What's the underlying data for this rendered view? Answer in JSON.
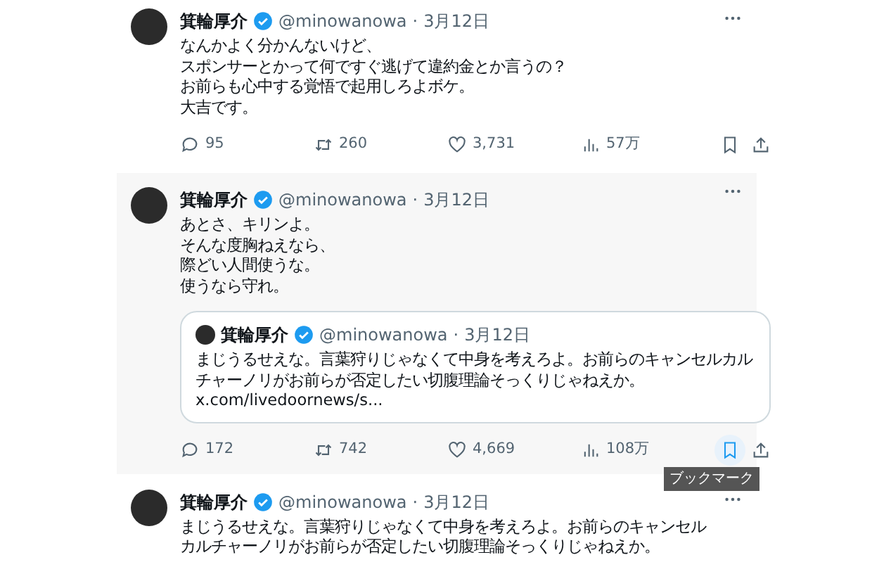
{
  "posts": [
    {
      "author": "箕輪厚介",
      "handle": "@minowanowa",
      "separator": "·",
      "date": "3月12日",
      "highlighted": false,
      "lines": [
        "なんかよく分かんないけど、",
        "スポンサーとかって何ですぐ逃げて違約金とか言うの？",
        "お前らも心中する覚悟で起用しろよボケ。",
        "大吉です。"
      ],
      "stats": {
        "replies": "95",
        "reposts": "260",
        "likes": "3,731",
        "views": "57万"
      },
      "bookmarked": false
    },
    {
      "author": "箕輪厚介",
      "handle": "@minowanowa",
      "separator": "·",
      "date": "3月12日",
      "highlighted": true,
      "lines": [
        "あとさ、キリンよ。",
        "そんな度胸ねえなら、",
        "際どい人間使うな。",
        "使うなら守れ。"
      ],
      "quote": {
        "author": "箕輪厚介",
        "handle": "@minowanowa",
        "separator": "·",
        "date": "3月12日",
        "text": "まじうるせえな。言葉狩りじゃなくて中身を考えろよ。お前らのキャンセルカルチャーノリがお前らが否定したい切腹理論そっくりじゃねえか。",
        "link": "x.com/livedoornews/s..."
      },
      "stats": {
        "replies": "172",
        "reposts": "742",
        "likes": "4,669",
        "views": "108万"
      },
      "bookmarked": true,
      "tooltip": "ブックマーク"
    },
    {
      "author": "箕輪厚介",
      "handle": "@minowanowa",
      "separator": "·",
      "date": "3月12日",
      "highlighted": false,
      "lines": [
        "まじうるせえな。言葉狩りじゃなくて中身を考えろよ。お前らのキャンセル",
        "カルチャーノリがお前らが否定したい切腹理論そっくりじゃねえか。"
      ]
    }
  ]
}
